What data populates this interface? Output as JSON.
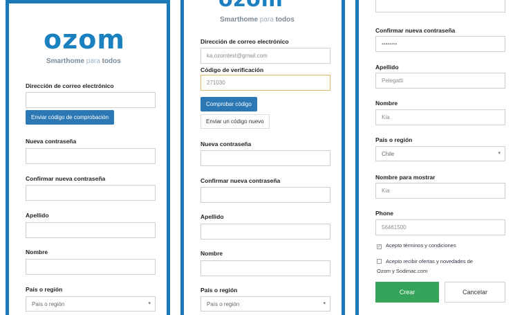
{
  "brand": {
    "logo": "ozom",
    "tagline_a": "Smarthome",
    "tagline_b": "para",
    "tagline_c": "todos"
  },
  "panel1": {
    "email_label": "Dirección de correo electrónico",
    "send_code_button": "Enviar código de comprobación",
    "new_password_label": "Nueva contraseña",
    "confirm_password_label": "Confirmar nueva contraseña",
    "surname_label": "Apellido",
    "name_label": "Nombre",
    "country_label": "País o región",
    "country_value": "País o región"
  },
  "panel2": {
    "email_label": "Dirección de correo electrónico",
    "email_value": "ka.ozomtest@gmail.com",
    "verification_label": "Código de verificación",
    "verification_value": "271030",
    "verify_button": "Comprobar código",
    "resend_button": "Enviar un código nuevo",
    "new_password_label": "Nueva contraseña",
    "confirm_password_label": "Confirmar nueva contraseña",
    "surname_label": "Apellido",
    "name_label": "Nombre",
    "country_label": "País o región",
    "country_value": "País o región"
  },
  "panel3": {
    "confirm_password_label": "Confirmar nueva contraseña",
    "confirm_password_value": "••••••••",
    "surname_label": "Apellido",
    "surname_value": "Pelegatti",
    "name_label": "Nombre",
    "name_value": "Kia",
    "country_label": "País o región",
    "country_value": "Chile",
    "display_name_label": "Nombre para mostrar",
    "display_name_value": "Kia",
    "phone_label": "Phone",
    "phone_value": "56461500",
    "terms_label": "Acepto términos y condiciones",
    "offers_label_line1": "Acepto recibir ofertas y novedades de",
    "offers_label_line2": "Ozom y Sodimac.com",
    "create_button": "Crear",
    "cancel_button": "Cancelar"
  },
  "colors": {
    "frame": "#1a7ab8",
    "primary_button": "#2b78b5",
    "create_button": "#36a35a"
  }
}
